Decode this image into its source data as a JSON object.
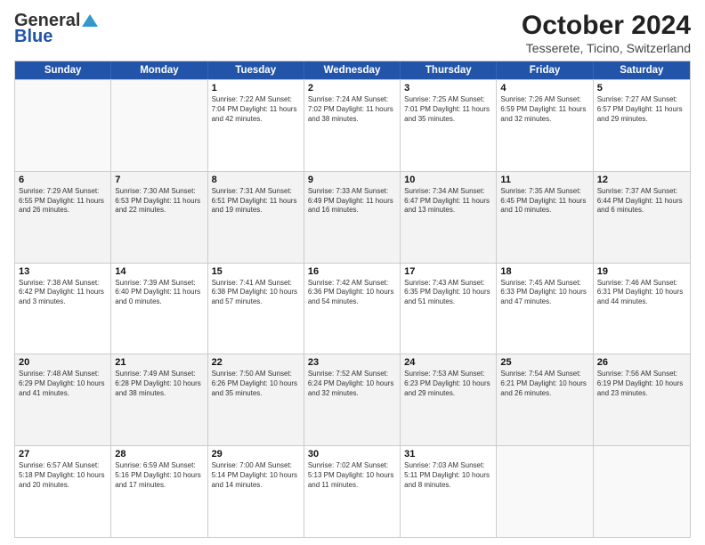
{
  "logo": {
    "general": "General",
    "blue": "Blue"
  },
  "title": "October 2024",
  "subtitle": "Tesserete, Ticino, Switzerland",
  "header_days": [
    "Sunday",
    "Monday",
    "Tuesday",
    "Wednesday",
    "Thursday",
    "Friday",
    "Saturday"
  ],
  "weeks": [
    [
      {
        "day": "",
        "info": ""
      },
      {
        "day": "",
        "info": ""
      },
      {
        "day": "1",
        "info": "Sunrise: 7:22 AM\nSunset: 7:04 PM\nDaylight: 11 hours and 42 minutes."
      },
      {
        "day": "2",
        "info": "Sunrise: 7:24 AM\nSunset: 7:02 PM\nDaylight: 11 hours and 38 minutes."
      },
      {
        "day": "3",
        "info": "Sunrise: 7:25 AM\nSunset: 7:01 PM\nDaylight: 11 hours and 35 minutes."
      },
      {
        "day": "4",
        "info": "Sunrise: 7:26 AM\nSunset: 6:59 PM\nDaylight: 11 hours and 32 minutes."
      },
      {
        "day": "5",
        "info": "Sunrise: 7:27 AM\nSunset: 6:57 PM\nDaylight: 11 hours and 29 minutes."
      }
    ],
    [
      {
        "day": "6",
        "info": "Sunrise: 7:29 AM\nSunset: 6:55 PM\nDaylight: 11 hours and 26 minutes."
      },
      {
        "day": "7",
        "info": "Sunrise: 7:30 AM\nSunset: 6:53 PM\nDaylight: 11 hours and 22 minutes."
      },
      {
        "day": "8",
        "info": "Sunrise: 7:31 AM\nSunset: 6:51 PM\nDaylight: 11 hours and 19 minutes."
      },
      {
        "day": "9",
        "info": "Sunrise: 7:33 AM\nSunset: 6:49 PM\nDaylight: 11 hours and 16 minutes."
      },
      {
        "day": "10",
        "info": "Sunrise: 7:34 AM\nSunset: 6:47 PM\nDaylight: 11 hours and 13 minutes."
      },
      {
        "day": "11",
        "info": "Sunrise: 7:35 AM\nSunset: 6:45 PM\nDaylight: 11 hours and 10 minutes."
      },
      {
        "day": "12",
        "info": "Sunrise: 7:37 AM\nSunset: 6:44 PM\nDaylight: 11 hours and 6 minutes."
      }
    ],
    [
      {
        "day": "13",
        "info": "Sunrise: 7:38 AM\nSunset: 6:42 PM\nDaylight: 11 hours and 3 minutes."
      },
      {
        "day": "14",
        "info": "Sunrise: 7:39 AM\nSunset: 6:40 PM\nDaylight: 11 hours and 0 minutes."
      },
      {
        "day": "15",
        "info": "Sunrise: 7:41 AM\nSunset: 6:38 PM\nDaylight: 10 hours and 57 minutes."
      },
      {
        "day": "16",
        "info": "Sunrise: 7:42 AM\nSunset: 6:36 PM\nDaylight: 10 hours and 54 minutes."
      },
      {
        "day": "17",
        "info": "Sunrise: 7:43 AM\nSunset: 6:35 PM\nDaylight: 10 hours and 51 minutes."
      },
      {
        "day": "18",
        "info": "Sunrise: 7:45 AM\nSunset: 6:33 PM\nDaylight: 10 hours and 47 minutes."
      },
      {
        "day": "19",
        "info": "Sunrise: 7:46 AM\nSunset: 6:31 PM\nDaylight: 10 hours and 44 minutes."
      }
    ],
    [
      {
        "day": "20",
        "info": "Sunrise: 7:48 AM\nSunset: 6:29 PM\nDaylight: 10 hours and 41 minutes."
      },
      {
        "day": "21",
        "info": "Sunrise: 7:49 AM\nSunset: 6:28 PM\nDaylight: 10 hours and 38 minutes."
      },
      {
        "day": "22",
        "info": "Sunrise: 7:50 AM\nSunset: 6:26 PM\nDaylight: 10 hours and 35 minutes."
      },
      {
        "day": "23",
        "info": "Sunrise: 7:52 AM\nSunset: 6:24 PM\nDaylight: 10 hours and 32 minutes."
      },
      {
        "day": "24",
        "info": "Sunrise: 7:53 AM\nSunset: 6:23 PM\nDaylight: 10 hours and 29 minutes."
      },
      {
        "day": "25",
        "info": "Sunrise: 7:54 AM\nSunset: 6:21 PM\nDaylight: 10 hours and 26 minutes."
      },
      {
        "day": "26",
        "info": "Sunrise: 7:56 AM\nSunset: 6:19 PM\nDaylight: 10 hours and 23 minutes."
      }
    ],
    [
      {
        "day": "27",
        "info": "Sunrise: 6:57 AM\nSunset: 5:18 PM\nDaylight: 10 hours and 20 minutes."
      },
      {
        "day": "28",
        "info": "Sunrise: 6:59 AM\nSunset: 5:16 PM\nDaylight: 10 hours and 17 minutes."
      },
      {
        "day": "29",
        "info": "Sunrise: 7:00 AM\nSunset: 5:14 PM\nDaylight: 10 hours and 14 minutes."
      },
      {
        "day": "30",
        "info": "Sunrise: 7:02 AM\nSunset: 5:13 PM\nDaylight: 10 hours and 11 minutes."
      },
      {
        "day": "31",
        "info": "Sunrise: 7:03 AM\nSunset: 5:11 PM\nDaylight: 10 hours and 8 minutes."
      },
      {
        "day": "",
        "info": ""
      },
      {
        "day": "",
        "info": ""
      }
    ]
  ]
}
